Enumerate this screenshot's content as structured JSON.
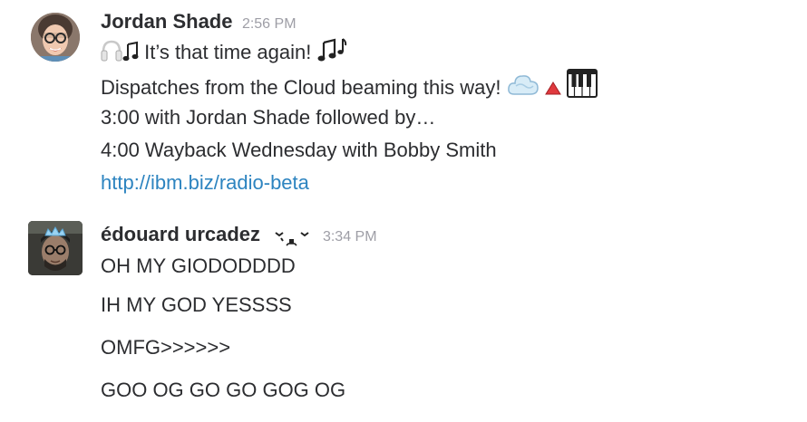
{
  "messages": [
    {
      "author": "Jordan Shade",
      "timestamp": "2:56 PM",
      "avatar_icon": "woman-with-glasses-avatar",
      "lines": {
        "l1_text": " It’s that time again! ",
        "l2_text": "Dispatches from the Cloud beaming this way! ",
        "l3_text": "3:00 with Jordan Shade followed by…",
        "l4_text": "4:00 Wayback Wednesday with Bobby Smith",
        "link": "http://ibm.biz/radio-beta"
      },
      "emojis": [
        "headphones-icon",
        "music-notes-icon",
        "cloud-icon",
        "red-triangle-icon",
        "piano-keys-icon"
      ]
    },
    {
      "author": "édouard urcadez",
      "timestamp": "3:34 PM",
      "avatar_icon": "man-with-crown-avatar",
      "status_icon": "sleepy-face-icon",
      "lines": [
        "OH MY GIODODDDD",
        "IH MY GOD YESSSS",
        "OMFG>>>>>>",
        "GOO OG GO GO GOG OG"
      ]
    }
  ],
  "colors": {
    "text": "#2c2d30",
    "timestamp": "#9e9ea6",
    "link": "#2d84c0"
  }
}
